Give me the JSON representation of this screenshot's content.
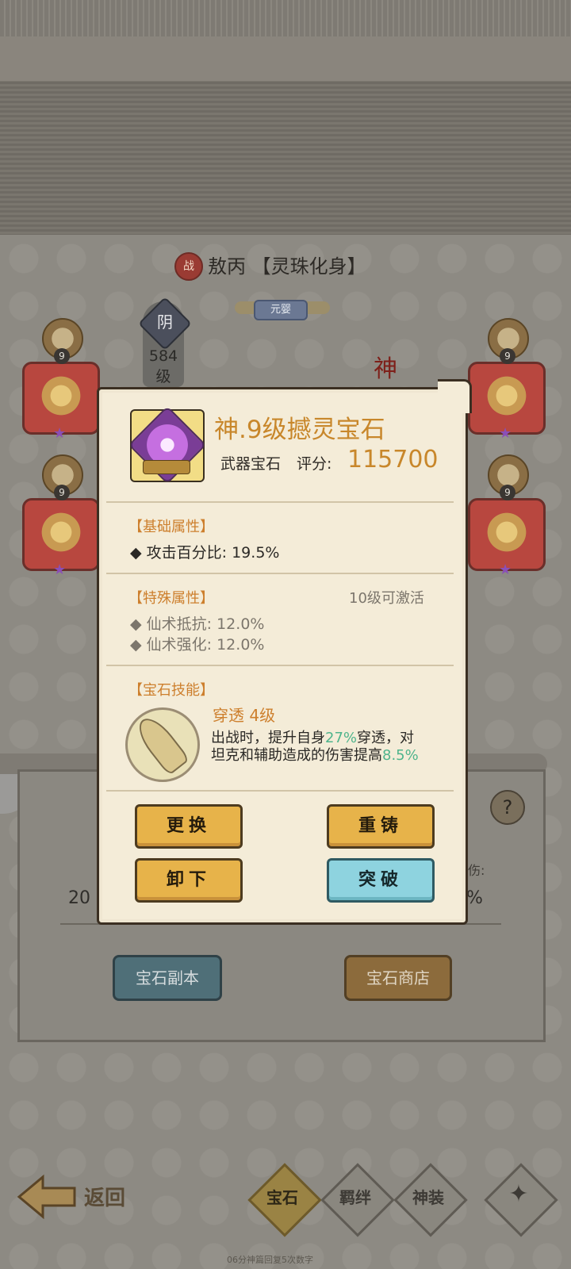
{
  "header": {
    "war_badge": "战",
    "hero_name": "敖丙 【灵珠化身】",
    "realm": "元婴",
    "yin": "阴",
    "level_number": "584",
    "level_unit": "级",
    "god_badge": "神"
  },
  "slots": [
    {
      "level": "9"
    },
    {
      "level": "9"
    },
    {
      "level": "9"
    },
    {
      "level": "9"
    }
  ],
  "dialog": {
    "gem_title": "神.9级撼灵宝石",
    "gem_type": "武器宝石",
    "score_label": "评分:",
    "score_value": "115700",
    "basic_title": "【基础属性】",
    "basic_attrs": [
      "攻击百分比: 19.5%"
    ],
    "special_title": "【特殊属性】",
    "activate_note": "10级可激活",
    "special_attrs": [
      "仙术抵抗: 12.0%",
      "仙术强化: 12.0%"
    ],
    "skill_title": "【宝石技能】",
    "skill_name": "穿透  4级",
    "skill_desc_1_a": "出战时，提升自身",
    "skill_desc_1_hl": "27%",
    "skill_desc_1_b": "穿透，对",
    "skill_desc_2_a": "坦克和辅助造成的伤害提高",
    "skill_desc_2_hl": "8.5%",
    "btn_replace": "更换",
    "btn_recast": "重铸",
    "btn_unload": "卸下",
    "btn_break": "突破"
  },
  "lower": {
    "left_label": "",
    "left_value": "20",
    "right_label": "伤:",
    "right_value": "%",
    "help": "?",
    "gem_dungeon": "宝石副本",
    "gem_shop": "宝石商店"
  },
  "nav": {
    "back": "返回",
    "tabs": [
      "宝石",
      "羁绊",
      "神装"
    ]
  },
  "footer_note": "06分神篇回复5次数字"
}
